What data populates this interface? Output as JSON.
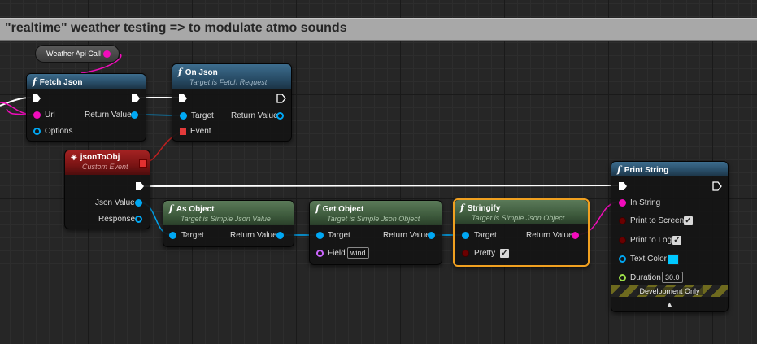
{
  "comment": {
    "title": "\"realtime\" weather testing => to modulate atmo sounds"
  },
  "variable_node": {
    "label": "Weather Api Call"
  },
  "fetch_json": {
    "title": "Fetch Json",
    "pins": {
      "url": "Url",
      "options": "Options",
      "return_value": "Return Value"
    }
  },
  "on_json": {
    "title": "On Json",
    "subtitle": "Target is Fetch Request",
    "pins": {
      "target": "Target",
      "return_value": "Return Value",
      "event": "Event"
    }
  },
  "json_to_obj": {
    "title": "jsonToObj",
    "subtitle": "Custom Event",
    "pins": {
      "json_value": "Json Value",
      "response": "Response"
    }
  },
  "as_object": {
    "title": "As Object",
    "subtitle": "Target is Simple Json Value",
    "pins": {
      "target": "Target",
      "return_value": "Return Value"
    }
  },
  "get_object": {
    "title": "Get Object",
    "subtitle": "Target is Simple Json Object",
    "pins": {
      "target": "Target",
      "return_value": "Return Value",
      "field": "Field",
      "field_value": "wind"
    }
  },
  "stringify": {
    "title": "Stringify",
    "subtitle": "Target is Simple Json Object",
    "pins": {
      "target": "Target",
      "return_value": "Return Value",
      "pretty": "Pretty",
      "pretty_checked": "✓"
    }
  },
  "print_string": {
    "title": "Print String",
    "pins": {
      "in_string": "In String",
      "print_to_screen": "Print to Screen",
      "print_to_screen_checked": "✓",
      "print_to_log": "Print to Log",
      "print_to_log_checked": "✓",
      "text_color": "Text Color",
      "duration": "Duration",
      "duration_value": "30.0"
    },
    "dev_only": "Development Only",
    "expand_icon": "▲"
  },
  "colors": {
    "exec": "#ffffff",
    "string_pin": "#f20cbc",
    "object_pin": "#00a8f4",
    "bool_pin": "#6b0000",
    "name_pin": "#cc66ff",
    "float_pin": "#9ee04a",
    "text_color_swatch": "#00c8ff",
    "selected_outline": "#f0a020"
  }
}
